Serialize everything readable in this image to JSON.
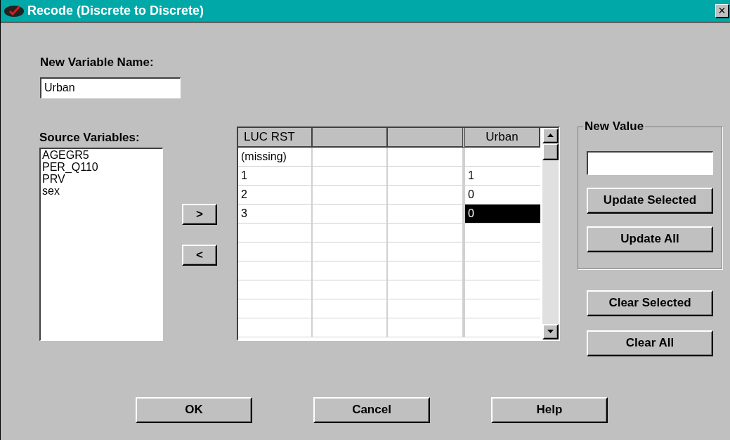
{
  "window": {
    "title": "Recode (Discrete to Discrete)",
    "close": "×"
  },
  "new_variable": {
    "label": "New Variable Name:",
    "value": "Urban"
  },
  "source_variables": {
    "label": "Source Variables:",
    "items": [
      "AGEGR5",
      "PER_Q110",
      "PRV",
      "sex"
    ]
  },
  "move_buttons": [
    ">",
    "<"
  ],
  "grid": {
    "source_header": "LUC RST",
    "new_header": "Urban",
    "rows": [
      {
        "source": "(missing)",
        "new_value": null,
        "selected": false
      },
      {
        "source": "1",
        "new_value": "1",
        "selected": false
      },
      {
        "source": "2",
        "new_value": "0",
        "selected": false
      },
      {
        "source": "3",
        "new_value": "0",
        "selected": true
      }
    ]
  },
  "new_value_group": {
    "title": "New Value",
    "buttons": [
      "Update Selected",
      "Update All"
    ]
  },
  "clear_buttons": [
    "Clear Selected",
    "Clear All"
  ],
  "dialog_buttons": [
    "OK",
    "Cancel",
    "Help"
  ]
}
